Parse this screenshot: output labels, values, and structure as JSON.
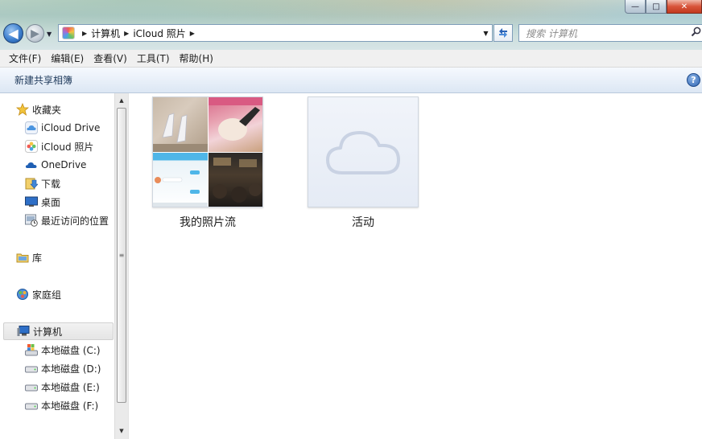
{
  "window": {
    "controls": {
      "minimize": "—",
      "maximize": "□",
      "close": "✕"
    }
  },
  "nav": {
    "back_glyph": "◀",
    "forward_glyph": "▶"
  },
  "address": {
    "segments": [
      "计算机",
      "iCloud 照片"
    ],
    "search_placeholder": "搜索 计算机",
    "icon": "icloud-photos-icon"
  },
  "menu": {
    "items": [
      "文件(F)",
      "编辑(E)",
      "查看(V)",
      "工具(T)",
      "帮助(H)"
    ]
  },
  "command_bar": {
    "new_shared_album": "新建共享相簿",
    "help_glyph": "?"
  },
  "sidebar": {
    "favorites": {
      "label": "收藏夹",
      "items": [
        {
          "label": "iCloud Drive",
          "icon": "icloud-drive-icon"
        },
        {
          "label": "iCloud 照片",
          "icon": "icloud-photos-icon"
        },
        {
          "label": "OneDrive",
          "icon": "onedrive-icon"
        },
        {
          "label": "下载",
          "icon": "downloads-icon"
        },
        {
          "label": "桌面",
          "icon": "desktop-icon"
        },
        {
          "label": "最近访问的位置",
          "icon": "recent-places-icon"
        }
      ]
    },
    "libraries": {
      "label": "库"
    },
    "homegroup": {
      "label": "家庭组"
    },
    "computer": {
      "label": "计算机",
      "drives": [
        {
          "label": "本地磁盘 (C:)"
        },
        {
          "label": "本地磁盘 (D:)"
        },
        {
          "label": "本地磁盘 (E:)"
        },
        {
          "label": "本地磁盘 (F:)"
        }
      ]
    }
  },
  "content": {
    "items": [
      {
        "label": "我的照片流",
        "type": "photo-stream"
      },
      {
        "label": "活动",
        "type": "activity"
      }
    ]
  },
  "colors": {
    "accent": "#2d63b0",
    "command_text": "#1e395b",
    "cloud_stroke": "#c9d2e3"
  }
}
